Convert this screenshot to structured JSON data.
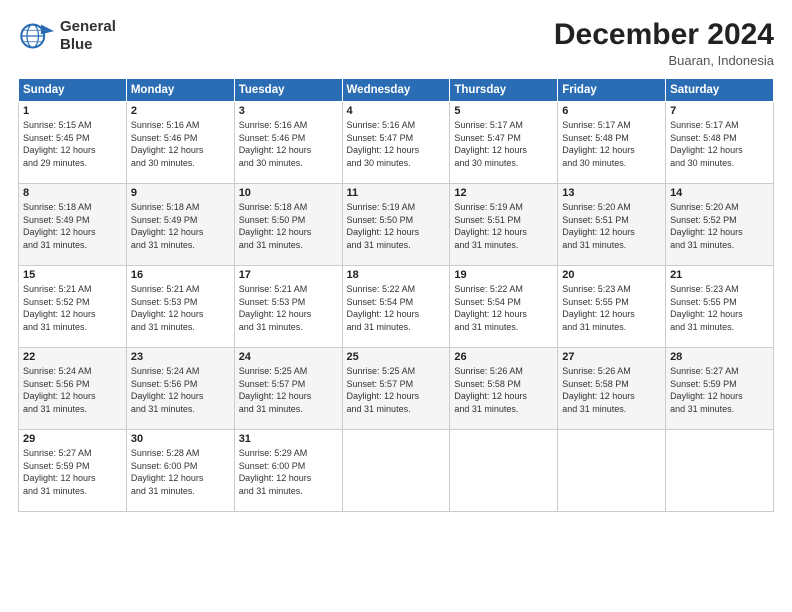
{
  "logo": {
    "line1": "General",
    "line2": "Blue"
  },
  "header": {
    "month": "December 2024",
    "location": "Buaran, Indonesia"
  },
  "weekdays": [
    "Sunday",
    "Monday",
    "Tuesday",
    "Wednesday",
    "Thursday",
    "Friday",
    "Saturday"
  ],
  "weeks": [
    [
      {
        "day": "1",
        "info": "Sunrise: 5:15 AM\nSunset: 5:45 PM\nDaylight: 12 hours\nand 29 minutes."
      },
      {
        "day": "2",
        "info": "Sunrise: 5:16 AM\nSunset: 5:46 PM\nDaylight: 12 hours\nand 30 minutes."
      },
      {
        "day": "3",
        "info": "Sunrise: 5:16 AM\nSunset: 5:46 PM\nDaylight: 12 hours\nand 30 minutes."
      },
      {
        "day": "4",
        "info": "Sunrise: 5:16 AM\nSunset: 5:47 PM\nDaylight: 12 hours\nand 30 minutes."
      },
      {
        "day": "5",
        "info": "Sunrise: 5:17 AM\nSunset: 5:47 PM\nDaylight: 12 hours\nand 30 minutes."
      },
      {
        "day": "6",
        "info": "Sunrise: 5:17 AM\nSunset: 5:48 PM\nDaylight: 12 hours\nand 30 minutes."
      },
      {
        "day": "7",
        "info": "Sunrise: 5:17 AM\nSunset: 5:48 PM\nDaylight: 12 hours\nand 30 minutes."
      }
    ],
    [
      {
        "day": "8",
        "info": "Sunrise: 5:18 AM\nSunset: 5:49 PM\nDaylight: 12 hours\nand 31 minutes."
      },
      {
        "day": "9",
        "info": "Sunrise: 5:18 AM\nSunset: 5:49 PM\nDaylight: 12 hours\nand 31 minutes."
      },
      {
        "day": "10",
        "info": "Sunrise: 5:18 AM\nSunset: 5:50 PM\nDaylight: 12 hours\nand 31 minutes."
      },
      {
        "day": "11",
        "info": "Sunrise: 5:19 AM\nSunset: 5:50 PM\nDaylight: 12 hours\nand 31 minutes."
      },
      {
        "day": "12",
        "info": "Sunrise: 5:19 AM\nSunset: 5:51 PM\nDaylight: 12 hours\nand 31 minutes."
      },
      {
        "day": "13",
        "info": "Sunrise: 5:20 AM\nSunset: 5:51 PM\nDaylight: 12 hours\nand 31 minutes."
      },
      {
        "day": "14",
        "info": "Sunrise: 5:20 AM\nSunset: 5:52 PM\nDaylight: 12 hours\nand 31 minutes."
      }
    ],
    [
      {
        "day": "15",
        "info": "Sunrise: 5:21 AM\nSunset: 5:52 PM\nDaylight: 12 hours\nand 31 minutes."
      },
      {
        "day": "16",
        "info": "Sunrise: 5:21 AM\nSunset: 5:53 PM\nDaylight: 12 hours\nand 31 minutes."
      },
      {
        "day": "17",
        "info": "Sunrise: 5:21 AM\nSunset: 5:53 PM\nDaylight: 12 hours\nand 31 minutes."
      },
      {
        "day": "18",
        "info": "Sunrise: 5:22 AM\nSunset: 5:54 PM\nDaylight: 12 hours\nand 31 minutes."
      },
      {
        "day": "19",
        "info": "Sunrise: 5:22 AM\nSunset: 5:54 PM\nDaylight: 12 hours\nand 31 minutes."
      },
      {
        "day": "20",
        "info": "Sunrise: 5:23 AM\nSunset: 5:55 PM\nDaylight: 12 hours\nand 31 minutes."
      },
      {
        "day": "21",
        "info": "Sunrise: 5:23 AM\nSunset: 5:55 PM\nDaylight: 12 hours\nand 31 minutes."
      }
    ],
    [
      {
        "day": "22",
        "info": "Sunrise: 5:24 AM\nSunset: 5:56 PM\nDaylight: 12 hours\nand 31 minutes."
      },
      {
        "day": "23",
        "info": "Sunrise: 5:24 AM\nSunset: 5:56 PM\nDaylight: 12 hours\nand 31 minutes."
      },
      {
        "day": "24",
        "info": "Sunrise: 5:25 AM\nSunset: 5:57 PM\nDaylight: 12 hours\nand 31 minutes."
      },
      {
        "day": "25",
        "info": "Sunrise: 5:25 AM\nSunset: 5:57 PM\nDaylight: 12 hours\nand 31 minutes."
      },
      {
        "day": "26",
        "info": "Sunrise: 5:26 AM\nSunset: 5:58 PM\nDaylight: 12 hours\nand 31 minutes."
      },
      {
        "day": "27",
        "info": "Sunrise: 5:26 AM\nSunset: 5:58 PM\nDaylight: 12 hours\nand 31 minutes."
      },
      {
        "day": "28",
        "info": "Sunrise: 5:27 AM\nSunset: 5:59 PM\nDaylight: 12 hours\nand 31 minutes."
      }
    ],
    [
      {
        "day": "29",
        "info": "Sunrise: 5:27 AM\nSunset: 5:59 PM\nDaylight: 12 hours\nand 31 minutes."
      },
      {
        "day": "30",
        "info": "Sunrise: 5:28 AM\nSunset: 6:00 PM\nDaylight: 12 hours\nand 31 minutes."
      },
      {
        "day": "31",
        "info": "Sunrise: 5:29 AM\nSunset: 6:00 PM\nDaylight: 12 hours\nand 31 minutes."
      },
      null,
      null,
      null,
      null
    ]
  ]
}
